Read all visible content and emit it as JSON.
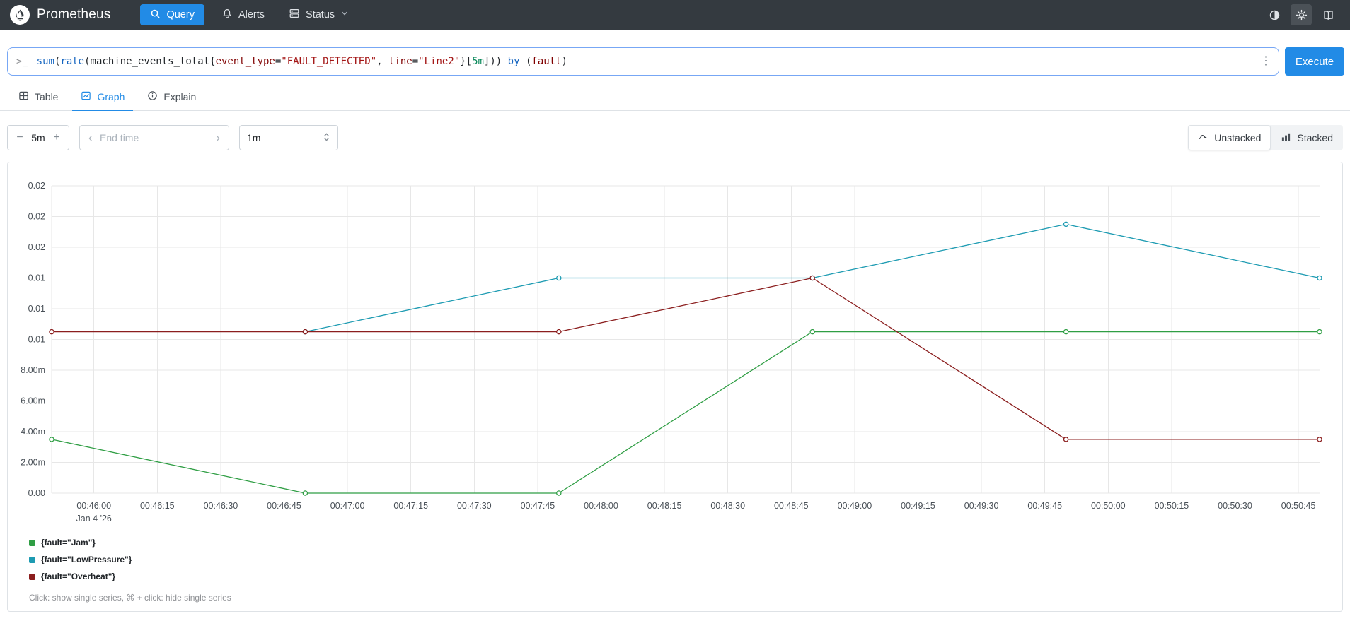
{
  "navbar": {
    "brand": "Prometheus",
    "query_label": "Query",
    "alerts_label": "Alerts",
    "status_label": "Status"
  },
  "query": {
    "prompt": ">_",
    "kebab": "⋮",
    "execute_label": "Execute",
    "tokens": [
      {
        "text": "sum",
        "type": "fn"
      },
      {
        "text": "(",
        "type": "punct"
      },
      {
        "text": "rate",
        "type": "fn"
      },
      {
        "text": "(",
        "type": "punct"
      },
      {
        "text": "machine_events_total",
        "type": "metric"
      },
      {
        "text": "{",
        "type": "punct"
      },
      {
        "text": "event_type",
        "type": "label"
      },
      {
        "text": "=",
        "type": "punct"
      },
      {
        "text": "\"FAULT_DETECTED\"",
        "type": "str"
      },
      {
        "text": ", ",
        "type": "punct"
      },
      {
        "text": "line",
        "type": "label"
      },
      {
        "text": "=",
        "type": "punct"
      },
      {
        "text": "\"Line2\"",
        "type": "str"
      },
      {
        "text": "}",
        "type": "punct"
      },
      {
        "text": "[",
        "type": "punct"
      },
      {
        "text": "5m",
        "type": "dur"
      },
      {
        "text": "]",
        "type": "punct"
      },
      {
        "text": "))",
        "type": "punct"
      },
      {
        "text": " ",
        "type": "punct"
      },
      {
        "text": "by",
        "type": "kw"
      },
      {
        "text": " ",
        "type": "punct"
      },
      {
        "text": "(",
        "type": "punct"
      },
      {
        "text": "fault",
        "type": "label"
      },
      {
        "text": ")",
        "type": "punct"
      }
    ]
  },
  "tabs": {
    "table": "Table",
    "graph": "Graph",
    "explain": "Explain"
  },
  "controls": {
    "duration_minus": "−",
    "duration": "5m",
    "duration_plus": "+",
    "end_time_placeholder": "End time",
    "chevron_left": "‹",
    "chevron_right": "›",
    "resolution": "1m",
    "unstacked": "Unstacked",
    "stacked": "Stacked"
  },
  "graph": {
    "footer_hint": "Click: show single series, ⌘ + click: hide single series"
  },
  "colors": {
    "accent": "#228be6",
    "navbar_bg": "#343a40",
    "grid": "#e7e7e7",
    "tick_text": "#495057"
  },
  "chart_data": {
    "type": "line",
    "title": "",
    "xlabel": "",
    "ylabel": "",
    "grid": true,
    "legend_position": "bottom",
    "x_domain_seconds": [
      0,
      300
    ],
    "y_domain": [
      0,
      0.02
    ],
    "x_axis_sub_label": "Jan 4 '26",
    "x_ticks": [
      {
        "t": 10,
        "label": "00:46:00"
      },
      {
        "t": 25,
        "label": "00:46:15"
      },
      {
        "t": 40,
        "label": "00:46:30"
      },
      {
        "t": 55,
        "label": "00:46:45"
      },
      {
        "t": 70,
        "label": "00:47:00"
      },
      {
        "t": 85,
        "label": "00:47:15"
      },
      {
        "t": 100,
        "label": "00:47:30"
      },
      {
        "t": 115,
        "label": "00:47:45"
      },
      {
        "t": 130,
        "label": "00:48:00"
      },
      {
        "t": 145,
        "label": "00:48:15"
      },
      {
        "t": 160,
        "label": "00:48:30"
      },
      {
        "t": 175,
        "label": "00:48:45"
      },
      {
        "t": 190,
        "label": "00:49:00"
      },
      {
        "t": 205,
        "label": "00:49:15"
      },
      {
        "t": 220,
        "label": "00:49:30"
      },
      {
        "t": 235,
        "label": "00:49:45"
      },
      {
        "t": 250,
        "label": "00:50:00"
      },
      {
        "t": 265,
        "label": "00:50:15"
      },
      {
        "t": 280,
        "label": "00:50:30"
      },
      {
        "t": 295,
        "label": "00:50:45"
      }
    ],
    "y_ticks": [
      0,
      0.002,
      0.004,
      0.006,
      0.008,
      0.01,
      0.012,
      0.014,
      0.016,
      0.018,
      0.02
    ],
    "y_tick_labels": [
      "0.00",
      "2.00m",
      "4.00m",
      "6.00m",
      "8.00m",
      "0.01",
      "0.01",
      "0.01",
      "0.02",
      "0.02",
      "0.02"
    ],
    "series": [
      {
        "name": "{fault=\"Jam\"}",
        "color": "#2f9e44",
        "t": [
          0,
          60,
          120,
          180,
          240,
          300
        ],
        "values": [
          0.0035,
          0,
          0,
          0.0105,
          0.0105,
          0.0105
        ]
      },
      {
        "name": "{fault=\"LowPressure\"}",
        "color": "#1d9bb2",
        "t": [
          60,
          120,
          180,
          240,
          300
        ],
        "values": [
          0.0105,
          0.014,
          0.014,
          0.0175,
          0.014
        ]
      },
      {
        "name": "{fault=\"Overheat\"}",
        "color": "#8b1e1e",
        "t": [
          0,
          60,
          120,
          180,
          240,
          300
        ],
        "values": [
          0.0105,
          0.0105,
          0.0105,
          0.014,
          0.0035,
          0.0035
        ]
      }
    ]
  }
}
